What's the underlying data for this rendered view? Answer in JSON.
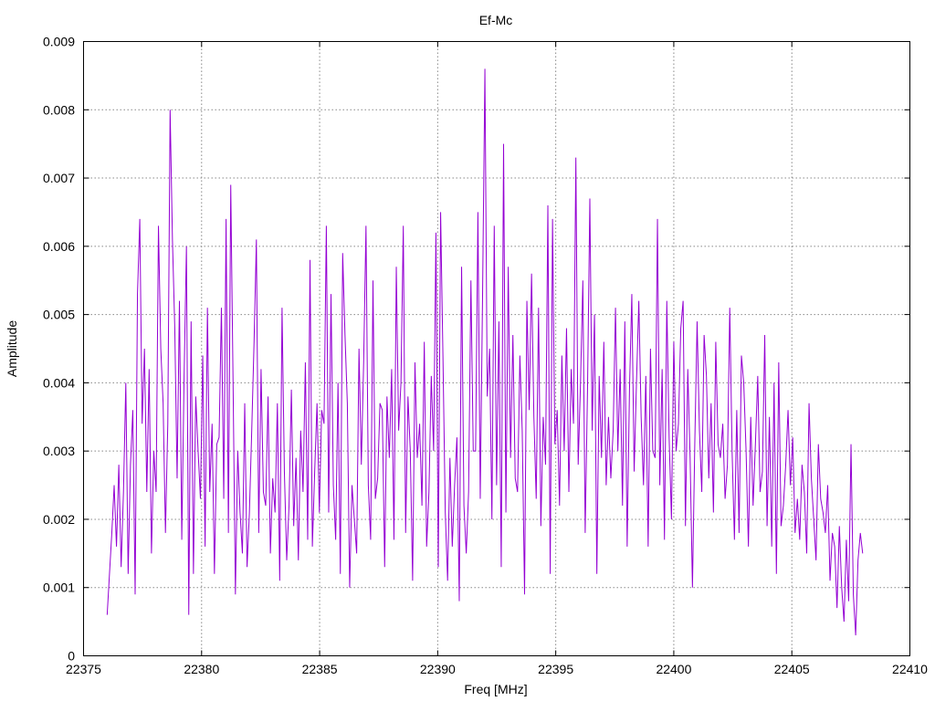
{
  "chart_data": {
    "type": "line",
    "title": "Ef-Mc",
    "xlabel": "Freq [MHz]",
    "ylabel": "Amplitude",
    "xlim": [
      22375,
      22410
    ],
    "ylim": [
      0,
      0.009
    ],
    "xticks": [
      "22375",
      "22380",
      "22385",
      "22390",
      "22395",
      "22400",
      "22405",
      "22410"
    ],
    "yticks": [
      "0",
      "0.001",
      "0.002",
      "0.003",
      "0.004",
      "0.005",
      "0.006",
      "0.007",
      "0.008",
      "0.009"
    ],
    "grid": true,
    "legend": "none",
    "line_color": "#9400d3",
    "series": [
      {
        "x_start": 22376.0,
        "x_end": 22408.0,
        "values": [
          0.0006,
          0.0012,
          0.0018,
          0.0025,
          0.0016,
          0.0028,
          0.0013,
          0.0024,
          0.004,
          0.0012,
          0.0028,
          0.0036,
          0.0009,
          0.0053,
          0.0064,
          0.0034,
          0.0045,
          0.0024,
          0.0042,
          0.0015,
          0.003,
          0.0024,
          0.0063,
          0.0045,
          0.0037,
          0.0018,
          0.0034,
          0.008,
          0.0061,
          0.0048,
          0.0026,
          0.0052,
          0.0017,
          0.0041,
          0.006,
          0.0006,
          0.0049,
          0.0012,
          0.0038,
          0.003,
          0.0023,
          0.0044,
          0.0016,
          0.0051,
          0.0024,
          0.0034,
          0.0012,
          0.0031,
          0.0032,
          0.0051,
          0.0023,
          0.0064,
          0.0018,
          0.0069,
          0.004,
          0.0009,
          0.003,
          0.0021,
          0.0015,
          0.0037,
          0.0013,
          0.0021,
          0.0033,
          0.0046,
          0.0061,
          0.0018,
          0.0042,
          0.0024,
          0.0022,
          0.0038,
          0.0015,
          0.0026,
          0.0021,
          0.0037,
          0.0011,
          0.0051,
          0.0027,
          0.0014,
          0.0022,
          0.0039,
          0.0019,
          0.0029,
          0.0014,
          0.0033,
          0.0024,
          0.0043,
          0.0017,
          0.0058,
          0.0016,
          0.0027,
          0.0037,
          0.0021,
          0.0036,
          0.0034,
          0.0063,
          0.0021,
          0.0053,
          0.0025,
          0.0017,
          0.004,
          0.0012,
          0.0059,
          0.0047,
          0.0037,
          0.001,
          0.0025,
          0.002,
          0.0015,
          0.0045,
          0.0028,
          0.0043,
          0.0063,
          0.0025,
          0.0017,
          0.0055,
          0.0023,
          0.0026,
          0.0037,
          0.0036,
          0.0013,
          0.0038,
          0.0029,
          0.0042,
          0.0017,
          0.0057,
          0.0033,
          0.004,
          0.0063,
          0.0018,
          0.0038,
          0.003,
          0.0011,
          0.0043,
          0.0029,
          0.0034,
          0.0022,
          0.0046,
          0.0016,
          0.0024,
          0.0041,
          0.003,
          0.0062,
          0.0013,
          0.0065,
          0.0044,
          0.0021,
          0.0011,
          0.0029,
          0.0016,
          0.0025,
          0.0032,
          0.0008,
          0.0057,
          0.0022,
          0.0015,
          0.0024,
          0.0055,
          0.003,
          0.003,
          0.0065,
          0.0023,
          0.0053,
          0.0086,
          0.0038,
          0.0045,
          0.002,
          0.0063,
          0.0025,
          0.0049,
          0.0013,
          0.0075,
          0.0021,
          0.0057,
          0.0029,
          0.0047,
          0.0026,
          0.0024,
          0.0044,
          0.0033,
          0.0009,
          0.0052,
          0.0036,
          0.0056,
          0.0035,
          0.0023,
          0.0051,
          0.0019,
          0.0035,
          0.0028,
          0.0066,
          0.0012,
          0.0064,
          0.0031,
          0.0036,
          0.0022,
          0.0044,
          0.003,
          0.0048,
          0.0024,
          0.0042,
          0.0034,
          0.0073,
          0.0028,
          0.004,
          0.0055,
          0.0018,
          0.0039,
          0.0067,
          0.0033,
          0.005,
          0.0012,
          0.0041,
          0.0029,
          0.0046,
          0.0025,
          0.0035,
          0.0026,
          0.0033,
          0.0051,
          0.003,
          0.0042,
          0.0022,
          0.0049,
          0.0016,
          0.0039,
          0.0053,
          0.0027,
          0.004,
          0.0052,
          0.0035,
          0.0025,
          0.0041,
          0.0016,
          0.0045,
          0.003,
          0.0029,
          0.0064,
          0.0025,
          0.0042,
          0.0017,
          0.0052,
          0.0032,
          0.002,
          0.0046,
          0.003,
          0.0034,
          0.0048,
          0.0052,
          0.0019,
          0.0042,
          0.0029,
          0.001,
          0.0031,
          0.0049,
          0.0033,
          0.0024,
          0.0047,
          0.0041,
          0.0026,
          0.0037,
          0.0021,
          0.0046,
          0.0031,
          0.0029,
          0.0034,
          0.0023,
          0.0028,
          0.0051,
          0.003,
          0.0017,
          0.0036,
          0.0018,
          0.0044,
          0.004,
          0.003,
          0.0016,
          0.0035,
          0.0022,
          0.0031,
          0.0041,
          0.0024,
          0.0027,
          0.0047,
          0.0019,
          0.0035,
          0.0016,
          0.004,
          0.0012,
          0.0043,
          0.0019,
          0.0022,
          0.0028,
          0.0036,
          0.0025,
          0.0032,
          0.0018,
          0.0023,
          0.0017,
          0.0028,
          0.0024,
          0.0015,
          0.0037,
          0.0026,
          0.002,
          0.0014,
          0.0031,
          0.0023,
          0.0021,
          0.0018,
          0.0025,
          0.0011,
          0.0018,
          0.0016,
          0.0007,
          0.0019,
          0.001,
          0.0005,
          0.0017,
          0.0008,
          0.0031,
          0.0009,
          0.0003,
          0.0014,
          0.0018,
          0.0015
        ]
      }
    ]
  }
}
